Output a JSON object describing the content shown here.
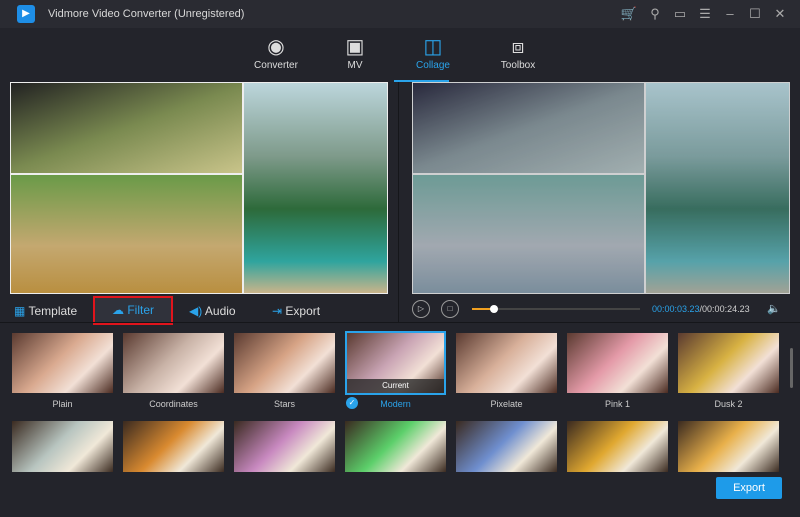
{
  "app": {
    "title": "Vidmore Video Converter (Unregistered)",
    "logo": "video-logo"
  },
  "window_controls": [
    "cart-icon",
    "key-icon",
    "feedback-icon",
    "menu-icon",
    "minimize-icon",
    "maximize-icon",
    "close-icon"
  ],
  "nav": [
    {
      "label": "Converter",
      "icon": "converter-icon"
    },
    {
      "label": "MV",
      "icon": "tv-icon"
    },
    {
      "label": "Collage",
      "icon": "collage-icon",
      "active": true
    },
    {
      "label": "Toolbox",
      "icon": "toolbox-icon"
    }
  ],
  "tabs": {
    "template": "Template",
    "filter": "Filter",
    "audio": "Audio",
    "export": "Export"
  },
  "player": {
    "current": "00:00:03.23",
    "total": "/00:00:24.23",
    "progress": 0.13
  },
  "filters": [
    {
      "label": "Plain",
      "tint": "#d9a98f"
    },
    {
      "label": "Coordinates",
      "tint": "#c8b2a6"
    },
    {
      "label": "Stars",
      "tint": "#d6a385"
    },
    {
      "label": "Modern",
      "tint": "#c9a4b4",
      "current": true
    },
    {
      "label": "Pixelate",
      "tint": "#d8b09a"
    },
    {
      "label": "Pink 1",
      "tint": "#e49aa8"
    },
    {
      "label": "Dusk 2",
      "tint": "#d8b243"
    }
  ],
  "filters_row2_tints": [
    "#b8c5c0",
    "#d98a30",
    "#c889c0",
    "#5ccf6a",
    "#6f8fcf",
    "#e0a830",
    "#e8b04a"
  ],
  "current_label": "Current",
  "export_button": "Export",
  "accent": "#1e9be9"
}
